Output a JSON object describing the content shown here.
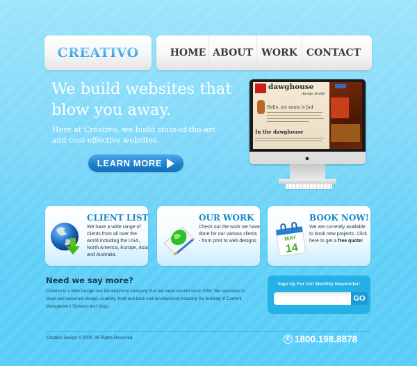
{
  "header": {
    "logo": "CREATIVO",
    "nav": [
      {
        "label": "HOME"
      },
      {
        "label": "ABOUT"
      },
      {
        "label": "WORK"
      },
      {
        "label": "CONTACT"
      }
    ]
  },
  "hero": {
    "title_line1": "We build websites that",
    "title_line2": "blow you away.",
    "subtitle_line1": "Here at Creativo, we build state-of-the-art",
    "subtitle_line2": "and cost-effective websites.",
    "cta_label": "LEARN MORE",
    "cta_icon": "play-arrow-icon",
    "showcase": {
      "site_logo": "dawghouse",
      "site_logo_sub": "design studio",
      "greeting": "Hello, my name is Jud",
      "section_title": "In the dawghouse"
    }
  },
  "features": [
    {
      "title": "CLIENT LIST",
      "icon": "globe-download-icon",
      "text": "We have a wide range of clients from all over the world including the USA, North America, Europe, Asia and Australia."
    },
    {
      "title": "OUR WORK",
      "icon": "paint-canvas-icon",
      "text": "Check out the work we have done for our various clients - from print to web designs."
    },
    {
      "title": "BOOK NOW!",
      "icon": "calendar-icon",
      "calendar_month": "MAY",
      "calendar_day": "14",
      "text_before": "We are currently available to book new projects. Click here to get a ",
      "text_bold": "free quote",
      "text_after": "!"
    }
  ],
  "about": {
    "title": "Need we say more?",
    "text": "Creativo is a Web Design and Development company that has been around since 1998. We specialize in clean and corporate design, usability, front and back end development including the building of Content Management Systems and blogs."
  },
  "newsletter": {
    "label": "Sign Up For Our Monthly Newsletter:",
    "input_value": "",
    "input_placeholder": "",
    "button_label": "GO"
  },
  "footer": {
    "copyright": "Creativo Design © 2009. All Rights Reserved.",
    "phone": "1800.198.8878",
    "phone_icon": "phone-icon"
  },
  "colors": {
    "accent": "#1a86c8",
    "button": "#1c7fce",
    "background": "#7fd8f9",
    "newsletter_bg": "#25b0e6"
  }
}
